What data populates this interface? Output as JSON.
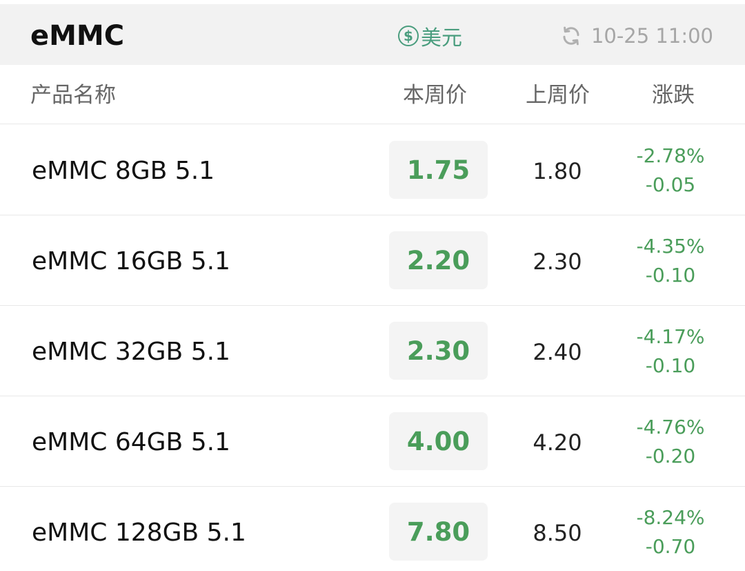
{
  "header": {
    "title": "eMMC",
    "currency_symbol": "$",
    "currency_label": "美元",
    "updated_at": "10-25 11:00"
  },
  "columns": {
    "name": "产品名称",
    "this_week": "本周价",
    "last_week": "上周价",
    "change": "涨跌"
  },
  "rows": [
    {
      "name": "eMMC 8GB 5.1",
      "this_week": "1.75",
      "last_week": "1.80",
      "change_pct": "-2.78%",
      "change_abs": "-0.05"
    },
    {
      "name": "eMMC 16GB 5.1",
      "this_week": "2.20",
      "last_week": "2.30",
      "change_pct": "-4.35%",
      "change_abs": "-0.10"
    },
    {
      "name": "eMMC 32GB 5.1",
      "this_week": "2.30",
      "last_week": "2.40",
      "change_pct": "-4.17%",
      "change_abs": "-0.10"
    },
    {
      "name": "eMMC 64GB 5.1",
      "this_week": "4.00",
      "last_week": "4.20",
      "change_pct": "-4.76%",
      "change_abs": "-0.20"
    },
    {
      "name": "eMMC 128GB 5.1",
      "this_week": "7.80",
      "last_week": "8.50",
      "change_pct": "-8.24%",
      "change_abs": "-0.70"
    }
  ],
  "colors": {
    "accent_green": "#4a9d5a",
    "currency_teal": "#4a9d7e",
    "muted_gray": "#a6a6a6"
  },
  "icons": {
    "currency": "dollar-circle-icon",
    "refresh": "refresh-icon"
  }
}
